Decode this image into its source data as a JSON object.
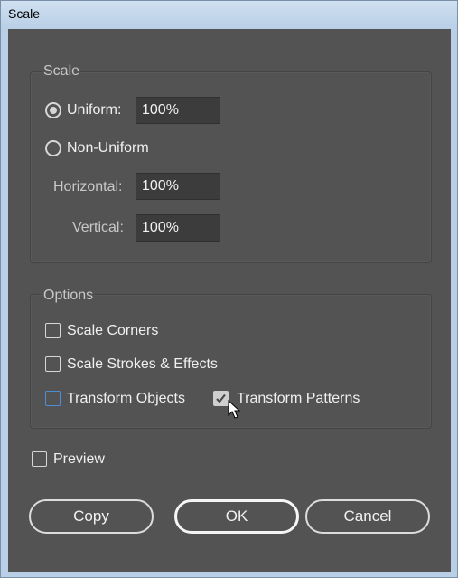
{
  "window": {
    "title": "Scale"
  },
  "scale_group": {
    "title": "Scale",
    "uniform": {
      "label": "Uniform:",
      "value": "100%",
      "selected": true
    },
    "non_uniform": {
      "label": "Non-Uniform",
      "selected": false
    },
    "horizontal": {
      "label": "Horizontal:",
      "value": "100%"
    },
    "vertical": {
      "label": "Vertical:",
      "value": "100%"
    }
  },
  "options_group": {
    "title": "Options",
    "scale_corners": {
      "label": "Scale Corners",
      "checked": false
    },
    "scale_strokes": {
      "label": "Scale Strokes & Effects",
      "checked": false
    },
    "transform_objects": {
      "label": "Transform Objects",
      "checked": false
    },
    "transform_patterns": {
      "label": "Transform Patterns",
      "checked": true
    }
  },
  "preview": {
    "label": "Preview",
    "checked": false
  },
  "buttons": {
    "copy": "Copy",
    "ok": "OK",
    "cancel": "Cancel"
  },
  "colors": {
    "dialog_bg": "#535353",
    "focus_blue": "#4b8fd8"
  },
  "icons": {
    "cursor": "mouse-pointer-icon",
    "check": "checkmark-icon"
  }
}
